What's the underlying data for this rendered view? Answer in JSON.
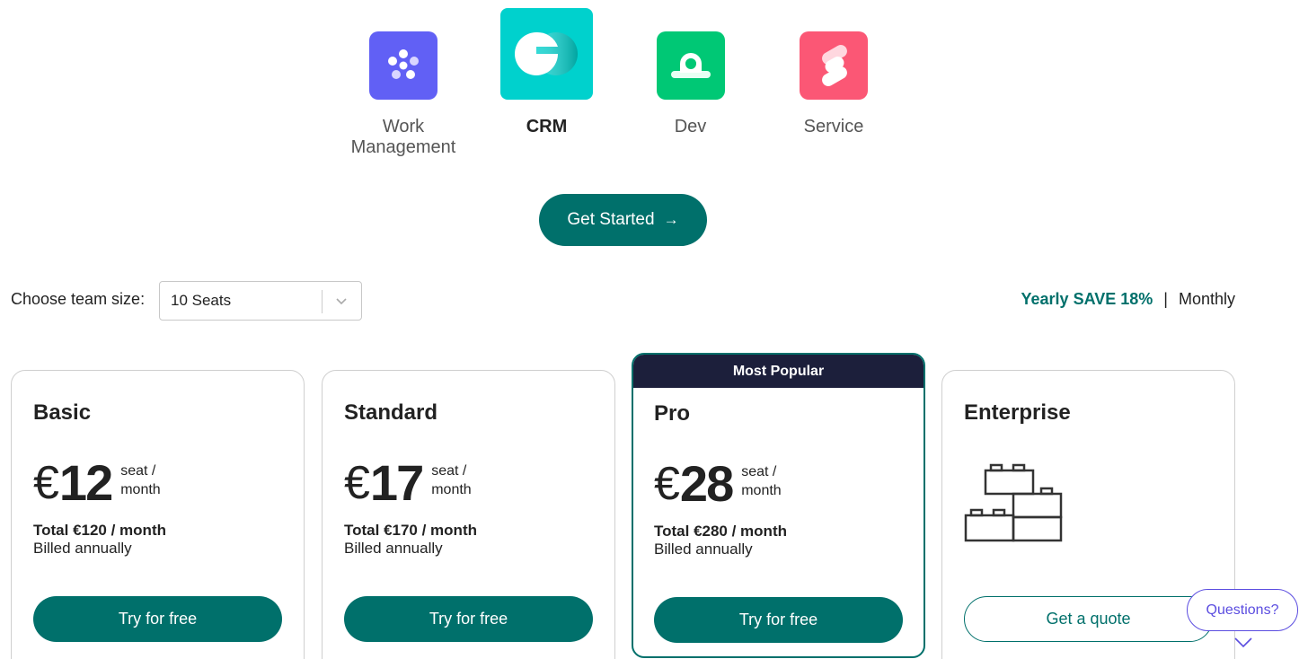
{
  "products": [
    {
      "name": "Work Management",
      "icon": "work-management-icon",
      "color": "#6160f5",
      "active": false
    },
    {
      "name": "CRM",
      "icon": "crm-icon",
      "color": "#00d1cd",
      "active": true
    },
    {
      "name": "Dev",
      "icon": "dev-icon",
      "color": "#00c875",
      "active": false
    },
    {
      "name": "Service",
      "icon": "service-icon",
      "color": "#fb5775",
      "active": false
    }
  ],
  "get_started": {
    "label": "Get Started",
    "arrow": "→"
  },
  "team_size": {
    "label": "Choose team size:",
    "value": "10 Seats"
  },
  "billing": {
    "yearly": "Yearly SAVE 18%",
    "separator": "|",
    "monthly": "Monthly"
  },
  "plans": [
    {
      "name": "Basic",
      "currency": "€",
      "price": "12",
      "unit": "seat / month",
      "total": "Total €120 / month",
      "billed": "Billed annually",
      "cta": "Try for free"
    },
    {
      "name": "Standard",
      "currency": "€",
      "price": "17",
      "unit": "seat / month",
      "total": "Total €170 / month",
      "billed": "Billed annually",
      "cta": "Try for free"
    },
    {
      "name": "Pro",
      "badge": "Most Popular",
      "currency": "€",
      "price": "28",
      "unit": "seat / month",
      "total": "Total €280 / month",
      "billed": "Billed annually",
      "cta": "Try for free"
    },
    {
      "name": "Enterprise",
      "icon": "building-blocks-icon",
      "cta": "Get a quote"
    }
  ],
  "questions": {
    "label": "Questions?"
  },
  "colors": {
    "accent": "#00706b",
    "dark_banner": "#1c1f3b",
    "chat": "#5b4de0"
  }
}
